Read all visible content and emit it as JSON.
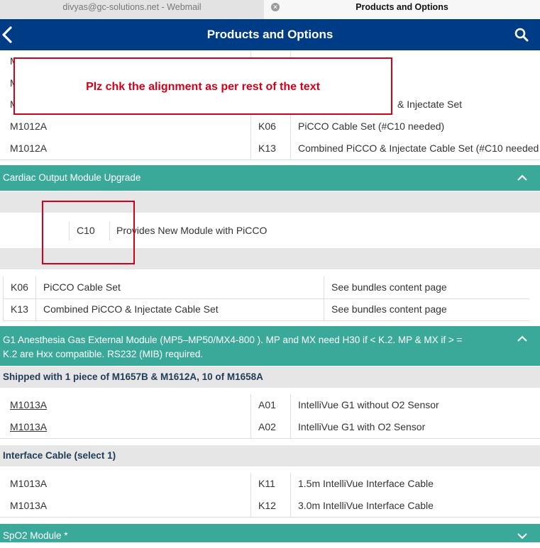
{
  "tabs": [
    {
      "label": "divyas@gc-solutions.net - Webmail"
    },
    {
      "label": "Products and Options"
    }
  ],
  "header": {
    "title": "Products and Options"
  },
  "annotations": {
    "note": "Plz chk the alignment as per rest of the text"
  },
  "top_rows": [
    {
      "part": "M",
      "option": "",
      "desc": ""
    },
    {
      "part": "M",
      "option": "",
      "desc": ""
    },
    {
      "part": "M",
      "option": "",
      "desc": "& Injectate Set"
    },
    {
      "part": "M1012A",
      "option": "K06",
      "desc": "PiCCO Cable Set (#C10 needed)"
    },
    {
      "part": "M1012A",
      "option": "K13",
      "desc": "Combined PiCCO & Injectate Cable Set (#C10 needed"
    }
  ],
  "cardiac": {
    "title": "Cardiac Output Module Upgrade",
    "row": {
      "option": "C10",
      "desc": "Provides New Module with PiCCO"
    },
    "bundles": [
      {
        "option": "K06",
        "desc": "PiCCO Cable Set",
        "note": "See bundles content page"
      },
      {
        "option": "K13",
        "desc": "Combined PiCCO & Injectate Cable Set",
        "note": "See bundles content page"
      }
    ]
  },
  "g1": {
    "title_line1": "G1 Anesthesia Gas External Module (MP5–MP50/MX4-800 ). MP and MX need H30 if < K.2. MP & MX if > =",
    "title_line2": "K.2 are Hxx compatible. RS232 (MIB) required.",
    "shipped": "Shipped with 1 piece of M1657B & M1612A, 10 of M1658A",
    "rows": [
      {
        "part": "M1013A",
        "option": "A01",
        "desc": "IntelliVue G1 without O2 Sensor"
      },
      {
        "part": "M1013A",
        "option": "A02",
        "desc": "IntelliVue G1 with O2 Sensor"
      }
    ],
    "interface_title": "Interface Cable (select 1)",
    "interface_rows": [
      {
        "part": "M1013A",
        "option": "K11",
        "desc": "1.5m IntelliVue Interface Cable"
      },
      {
        "part": "M1013A",
        "option": "K12",
        "desc": "3.0m IntelliVue Interface Cable"
      }
    ]
  },
  "spo2": {
    "title": "SpO2 Module *"
  },
  "colors": {
    "nav": "#003b85",
    "teal": "#3aa99a",
    "annotation": "#d0021b"
  }
}
